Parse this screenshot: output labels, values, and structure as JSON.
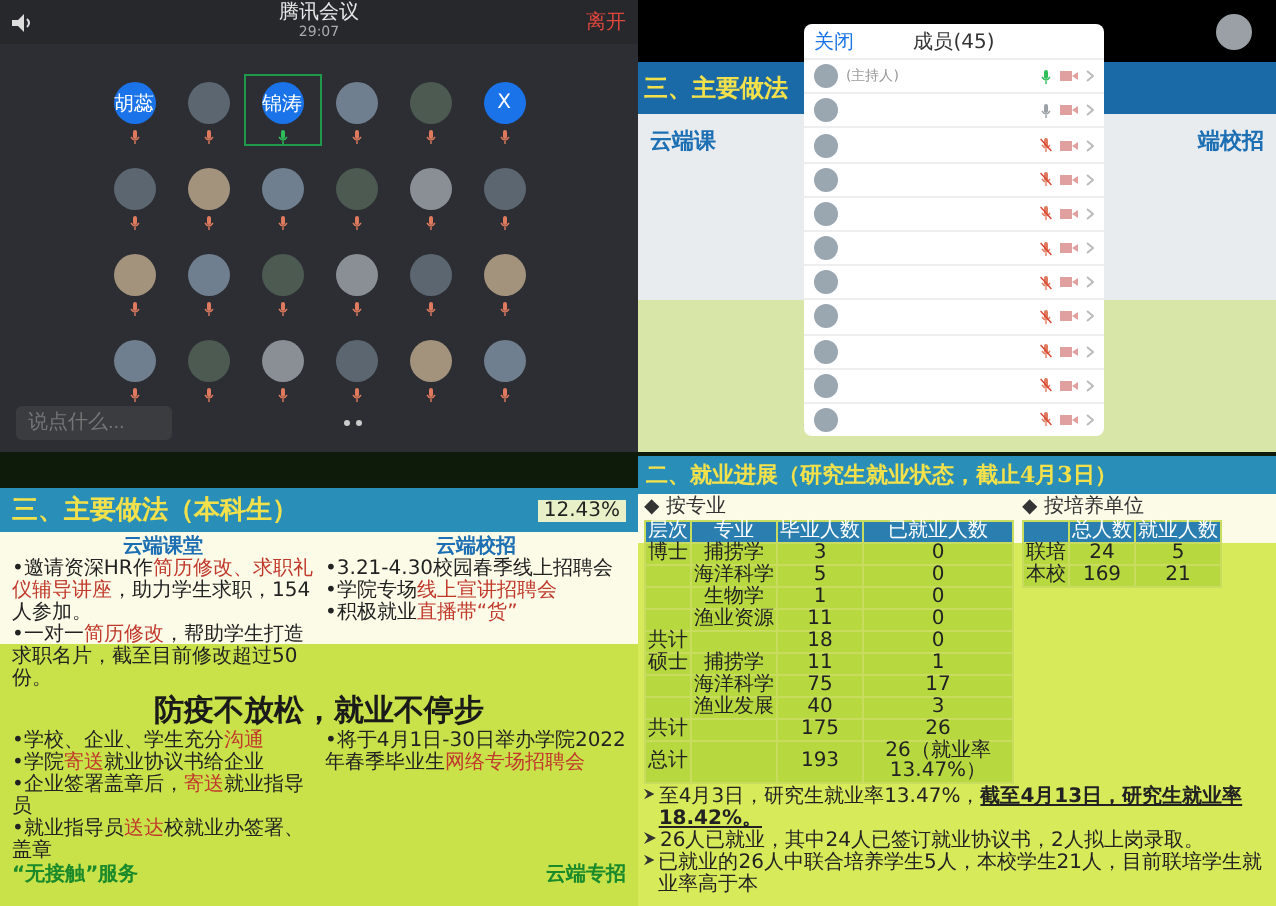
{
  "meeting": {
    "title": "腾讯会议",
    "timer": "29:07",
    "leave": "离开",
    "participants": [
      {
        "kind": "text",
        "initials": "胡蕊",
        "selected": false
      },
      {
        "kind": "photo",
        "selected": false
      },
      {
        "kind": "text",
        "initials": "锦涛",
        "selected": true
      },
      {
        "kind": "photo",
        "selected": false
      },
      {
        "kind": "photo",
        "selected": false
      },
      {
        "kind": "text",
        "initials": "X",
        "selected": false
      },
      {
        "kind": "photo",
        "selected": false
      },
      {
        "kind": "photo",
        "selected": false
      },
      {
        "kind": "photo",
        "selected": false
      },
      {
        "kind": "photo",
        "selected": false
      },
      {
        "kind": "photo",
        "selected": false
      },
      {
        "kind": "photo",
        "selected": false
      },
      {
        "kind": "photo",
        "selected": false
      },
      {
        "kind": "photo",
        "selected": false
      },
      {
        "kind": "photo",
        "selected": false
      },
      {
        "kind": "photo",
        "selected": false
      },
      {
        "kind": "photo",
        "selected": false
      },
      {
        "kind": "photo",
        "selected": false
      },
      {
        "kind": "photo",
        "selected": false
      },
      {
        "kind": "photo",
        "selected": false
      },
      {
        "kind": "photo",
        "selected": false
      },
      {
        "kind": "photo",
        "selected": false
      },
      {
        "kind": "photo",
        "selected": false
      },
      {
        "kind": "photo",
        "selected": false
      }
    ],
    "chat": {
      "placeholder": "说点什么..."
    }
  },
  "members_panel": {
    "close": "关闭",
    "title": "成员(45)",
    "host_note": "(主持人)",
    "members": [
      {
        "speaking": true,
        "muted": false
      },
      {
        "speaking": false,
        "muted": false
      },
      {
        "speaking": false,
        "muted": true
      },
      {
        "speaking": false,
        "muted": true
      },
      {
        "speaking": false,
        "muted": true
      },
      {
        "speaking": false,
        "muted": true
      },
      {
        "speaking": false,
        "muted": true
      },
      {
        "speaking": false,
        "muted": true
      },
      {
        "speaking": false,
        "muted": true
      },
      {
        "speaking": false,
        "muted": true
      },
      {
        "speaking": false,
        "muted": true
      }
    ]
  },
  "slide_top": {
    "title": "三、主要做法",
    "left_heading": "云端课",
    "right_heading": "端校招"
  },
  "slide_undergrad": {
    "title": "三、主要做法（本科生）",
    "left_heading": "云端课堂",
    "right_heading": "云端校招",
    "left_bullets": [
      "•邀请资深HR作**简历修改、求职礼仪辅导讲座**，助力学生求职，154人参加。",
      "•一对一**简历修改**，帮助学生打造求职名片，截至目前修改超过50份。"
    ],
    "right_bullets": [
      "•3.21-4.30校园春季线上招聘会",
      "•学院专场**线上宣讲招聘会**",
      "•积极就业**直播带“货”**"
    ],
    "banner": "防疫不放松，就业不停步",
    "lower_left_bullets": [
      "•学校、企业、学生充分**沟通**",
      "•学院**寄送**就业协议书给企业",
      "•企业签署盖章后，**寄送**就业指导员",
      "•就业指导员**送达**校就业办签署、盖章"
    ],
    "lower_right_bullets": [
      "•将于4月1日-30日举办学院2022年春季毕业生**网络专场招聘会**"
    ],
    "footer_left": "“无接触”服务",
    "footer_right": "云端专招",
    "side_rate": "12.43%"
  },
  "slide_grad": {
    "title": "二、就业进展（研究生就业状态，截止4月3日）",
    "by_major": "◆ 按专业",
    "by_unit": "◆ 按培养单位",
    "table": {
      "columns": [
        "层次",
        "专业",
        "毕业人数",
        "已就业人数"
      ],
      "rows": [
        [
          "博士",
          "捕捞学",
          "3",
          "0"
        ],
        [
          "",
          "海洋科学",
          "5",
          "0"
        ],
        [
          "",
          "生物学",
          "1",
          "0"
        ],
        [
          "",
          "渔业资源",
          "11",
          "0"
        ],
        [
          "共计",
          "",
          "18",
          "0"
        ],
        [
          "硕士",
          "捕捞学",
          "11",
          "1"
        ],
        [
          "",
          "海洋科学",
          "75",
          "17"
        ],
        [
          "",
          "渔业发展",
          "40",
          "3"
        ],
        [
          "共计",
          "",
          "175",
          "26"
        ],
        [
          "总计",
          "",
          "193",
          "26（就业率13.47%）"
        ]
      ]
    },
    "unit_table": {
      "columns": [
        "",
        "总人数",
        "就业人数"
      ],
      "rows": [
        [
          "联培",
          "24",
          "5"
        ],
        [
          "本校",
          "169",
          "21"
        ]
      ]
    },
    "bullets": [
      "至4月3日，研究生就业率13.47%，**截至4月13日，研究生就业率18.42%。**",
      "26人已就业，其中24人已签订就业协议书，2人拟上岗录取。",
      "已就业的26人中联合培养学生5人，本校学生21人，目前联培学生就业率高于本"
    ]
  }
}
